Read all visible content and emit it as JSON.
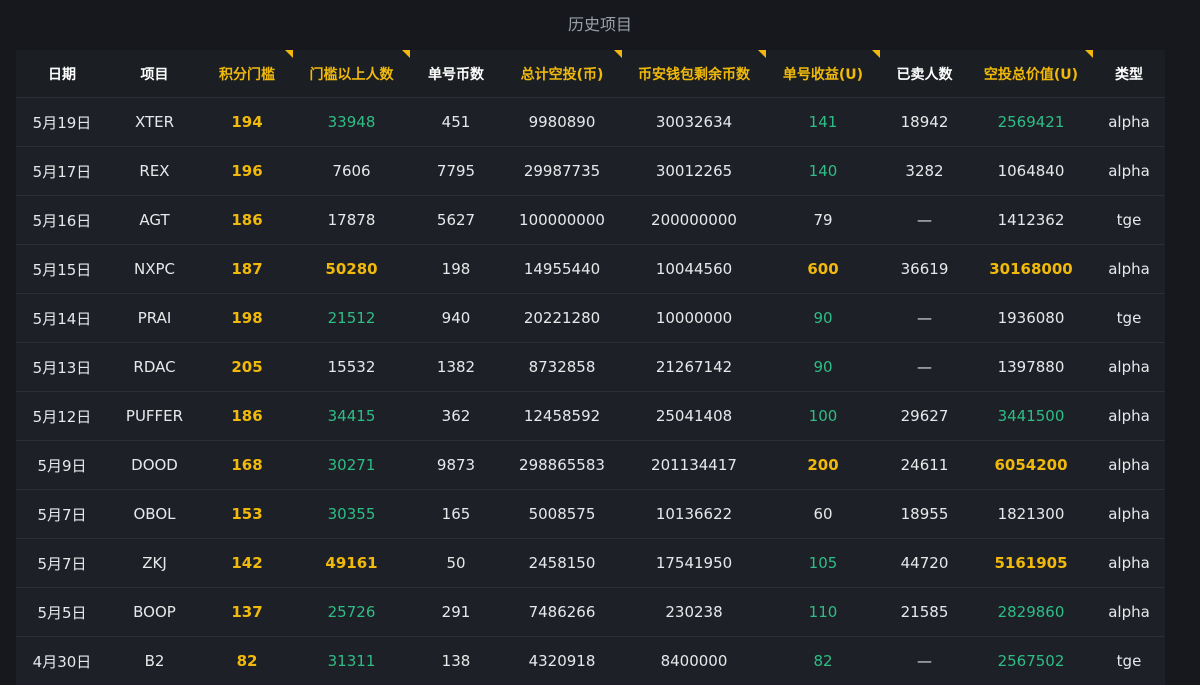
{
  "title": "历史项目",
  "headers": [
    {
      "label": "日期",
      "highlight": false
    },
    {
      "label": "项目",
      "highlight": false
    },
    {
      "label": "积分门槛",
      "highlight": true
    },
    {
      "label": "门槛以上人数",
      "highlight": true
    },
    {
      "label": "单号币数",
      "highlight": false
    },
    {
      "label": "总计空投(币)",
      "highlight": true
    },
    {
      "label": "币安钱包剩余币数",
      "highlight": true
    },
    {
      "label": "单号收益(U)",
      "highlight": true
    },
    {
      "label": "已卖人数",
      "highlight": false
    },
    {
      "label": "空投总价值(U)",
      "highlight": true
    },
    {
      "label": "类型",
      "highlight": false
    }
  ],
  "colors": {
    "accent_yellow": "#f0b90b",
    "accent_green": "#2ebd85",
    "background": "#16181d",
    "table_bg": "#1d2026"
  },
  "rows": [
    {
      "cells": [
        {
          "v": "5月19日"
        },
        {
          "v": "XTER"
        },
        {
          "v": "194",
          "c": "yellow"
        },
        {
          "v": "33948",
          "c": "green"
        },
        {
          "v": "451"
        },
        {
          "v": "9980890"
        },
        {
          "v": "30032634"
        },
        {
          "v": "141",
          "c": "green"
        },
        {
          "v": "18942"
        },
        {
          "v": "2569421",
          "c": "green"
        },
        {
          "v": "alpha"
        }
      ]
    },
    {
      "cells": [
        {
          "v": "5月17日"
        },
        {
          "v": "REX"
        },
        {
          "v": "196",
          "c": "yellow"
        },
        {
          "v": "7606"
        },
        {
          "v": "7795"
        },
        {
          "v": "29987735"
        },
        {
          "v": "30012265"
        },
        {
          "v": "140",
          "c": "green"
        },
        {
          "v": "3282"
        },
        {
          "v": "1064840"
        },
        {
          "v": "alpha"
        }
      ]
    },
    {
      "cells": [
        {
          "v": "5月16日"
        },
        {
          "v": "AGT"
        },
        {
          "v": "186",
          "c": "yellow"
        },
        {
          "v": "17878"
        },
        {
          "v": "5627"
        },
        {
          "v": "100000000"
        },
        {
          "v": "200000000"
        },
        {
          "v": "79"
        },
        {
          "v": "—"
        },
        {
          "v": "1412362"
        },
        {
          "v": "tge"
        }
      ]
    },
    {
      "cells": [
        {
          "v": "5月15日"
        },
        {
          "v": "NXPC"
        },
        {
          "v": "187",
          "c": "yellow"
        },
        {
          "v": "50280",
          "c": "yellow"
        },
        {
          "v": "198"
        },
        {
          "v": "14955440"
        },
        {
          "v": "10044560"
        },
        {
          "v": "600",
          "c": "yellow"
        },
        {
          "v": "36619"
        },
        {
          "v": "30168000",
          "c": "yellow"
        },
        {
          "v": "alpha"
        }
      ]
    },
    {
      "cells": [
        {
          "v": "5月14日"
        },
        {
          "v": "PRAI"
        },
        {
          "v": "198",
          "c": "yellow"
        },
        {
          "v": "21512",
          "c": "green"
        },
        {
          "v": "940"
        },
        {
          "v": "20221280"
        },
        {
          "v": "10000000"
        },
        {
          "v": "90",
          "c": "green"
        },
        {
          "v": "—"
        },
        {
          "v": "1936080"
        },
        {
          "v": "tge"
        }
      ]
    },
    {
      "cells": [
        {
          "v": "5月13日"
        },
        {
          "v": "RDAC"
        },
        {
          "v": "205",
          "c": "yellow"
        },
        {
          "v": "15532"
        },
        {
          "v": "1382"
        },
        {
          "v": "8732858"
        },
        {
          "v": "21267142"
        },
        {
          "v": "90",
          "c": "green"
        },
        {
          "v": "—"
        },
        {
          "v": "1397880"
        },
        {
          "v": "alpha"
        }
      ]
    },
    {
      "cells": [
        {
          "v": "5月12日"
        },
        {
          "v": "PUFFER"
        },
        {
          "v": "186",
          "c": "yellow"
        },
        {
          "v": "34415",
          "c": "green"
        },
        {
          "v": "362"
        },
        {
          "v": "12458592"
        },
        {
          "v": "25041408"
        },
        {
          "v": "100",
          "c": "green"
        },
        {
          "v": "29627"
        },
        {
          "v": "3441500",
          "c": "green"
        },
        {
          "v": "alpha"
        }
      ]
    },
    {
      "cells": [
        {
          "v": "5月9日"
        },
        {
          "v": "DOOD"
        },
        {
          "v": "168",
          "c": "yellow"
        },
        {
          "v": "30271",
          "c": "green"
        },
        {
          "v": "9873"
        },
        {
          "v": "298865583"
        },
        {
          "v": "201134417"
        },
        {
          "v": "200",
          "c": "yellow"
        },
        {
          "v": "24611"
        },
        {
          "v": "6054200",
          "c": "yellow"
        },
        {
          "v": "alpha"
        }
      ]
    },
    {
      "cells": [
        {
          "v": "5月7日"
        },
        {
          "v": "OBOL"
        },
        {
          "v": "153",
          "c": "yellow"
        },
        {
          "v": "30355",
          "c": "green"
        },
        {
          "v": "165"
        },
        {
          "v": "5008575"
        },
        {
          "v": "10136622"
        },
        {
          "v": "60"
        },
        {
          "v": "18955"
        },
        {
          "v": "1821300"
        },
        {
          "v": "alpha"
        }
      ]
    },
    {
      "cells": [
        {
          "v": "5月7日"
        },
        {
          "v": "ZKJ"
        },
        {
          "v": "142",
          "c": "yellow"
        },
        {
          "v": "49161",
          "c": "yellow"
        },
        {
          "v": "50"
        },
        {
          "v": "2458150"
        },
        {
          "v": "17541950"
        },
        {
          "v": "105",
          "c": "green"
        },
        {
          "v": "44720"
        },
        {
          "v": "5161905",
          "c": "yellow"
        },
        {
          "v": "alpha"
        }
      ]
    },
    {
      "cells": [
        {
          "v": "5月5日"
        },
        {
          "v": "BOOP"
        },
        {
          "v": "137",
          "c": "yellow"
        },
        {
          "v": "25726",
          "c": "green"
        },
        {
          "v": "291"
        },
        {
          "v": "7486266"
        },
        {
          "v": "230238"
        },
        {
          "v": "110",
          "c": "green"
        },
        {
          "v": "21585"
        },
        {
          "v": "2829860",
          "c": "green"
        },
        {
          "v": "alpha"
        }
      ]
    },
    {
      "cells": [
        {
          "v": "4月30日"
        },
        {
          "v": "B2"
        },
        {
          "v": "82",
          "c": "yellow"
        },
        {
          "v": "31311",
          "c": "green"
        },
        {
          "v": "138"
        },
        {
          "v": "4320918"
        },
        {
          "v": "8400000"
        },
        {
          "v": "82",
          "c": "green"
        },
        {
          "v": "—"
        },
        {
          "v": "2567502",
          "c": "green"
        },
        {
          "v": "tge"
        }
      ]
    }
  ]
}
